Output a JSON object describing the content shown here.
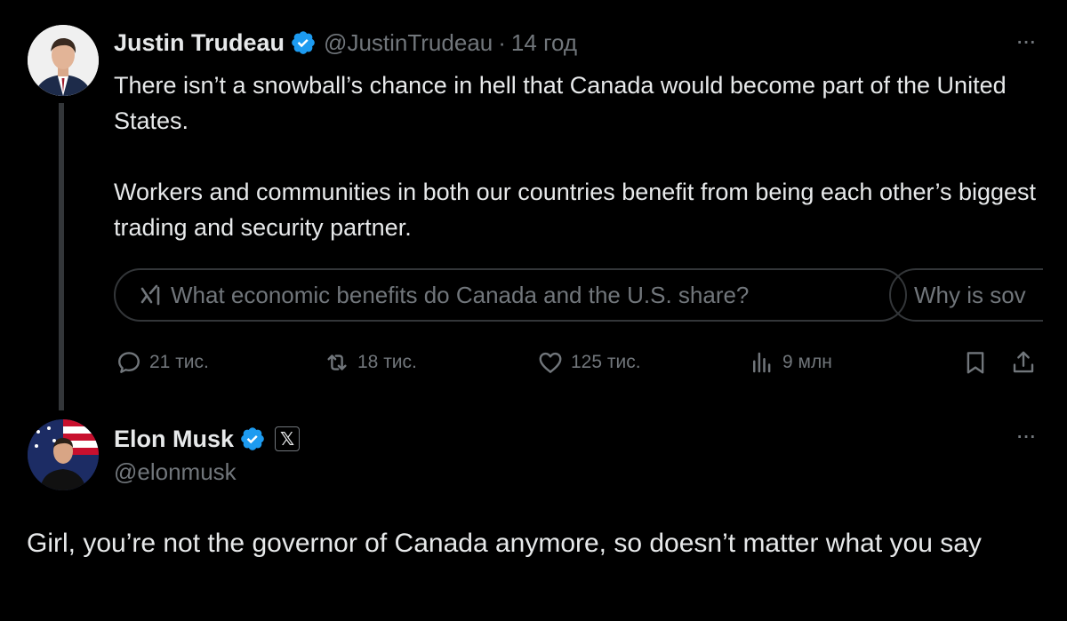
{
  "tweet1": {
    "author_name": "Justin Trudeau",
    "handle": "@JustinTrudeau",
    "separator": "·",
    "time": "14 год",
    "paragraphs": [
      "There isn’t a snowball’s chance in hell that Canada would become part of the United States.",
      "Workers and communities in both our countries benefit from being each other’s biggest trading and security partner."
    ],
    "grok_prompts": [
      "What economic benefits do Canada and the U.S. share?",
      "Why is sov"
    ],
    "actions": {
      "replies": "21 тис.",
      "reposts": "18 тис.",
      "likes": "125 тис.",
      "views": "9 млн"
    },
    "more_label": "···"
  },
  "tweet2": {
    "author_name": "Elon Musk",
    "badge_label": "𝕏",
    "handle": "@elonmusk",
    "text": "Girl, you’re not the governor of Canada anymore, so doesn’t matter what you say",
    "more_label": "···"
  },
  "icons": {
    "verified": "verified-badge-icon",
    "grok": "grok-icon",
    "reply": "reply-icon",
    "retweet": "retweet-icon",
    "like": "heart-icon",
    "views": "views-icon",
    "bookmark": "bookmark-icon",
    "share": "share-icon"
  },
  "colors": {
    "background": "#000000",
    "text_primary": "#e7e9ea",
    "text_secondary": "#71767b",
    "verified_blue": "#1d9bf0",
    "border": "#333639"
  }
}
